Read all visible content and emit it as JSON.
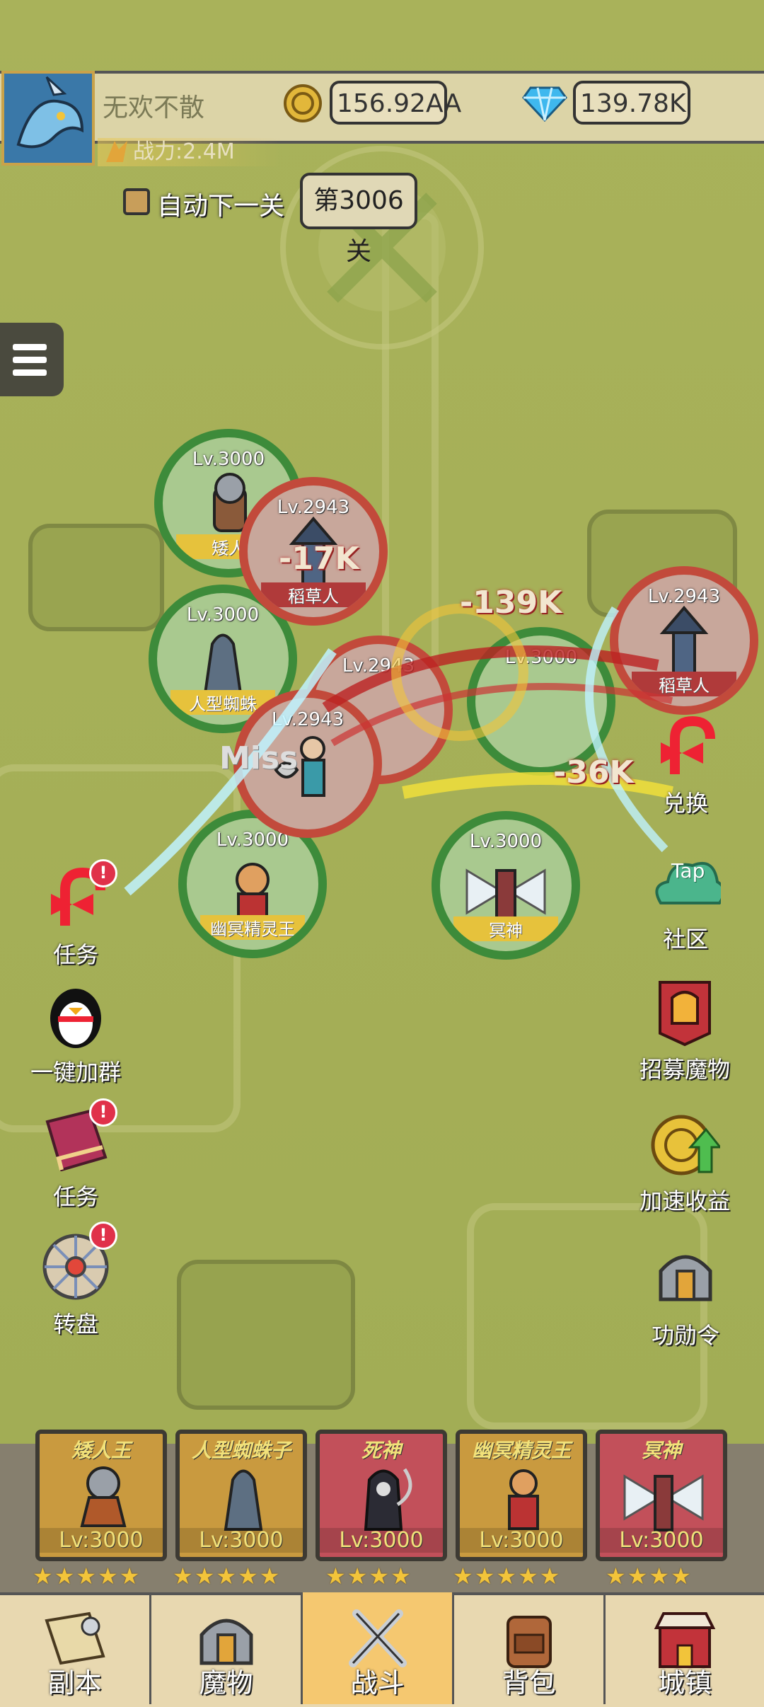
{
  "player": {
    "name": "无欢不散",
    "power": "战力:2.4M",
    "gold": "156.92AA",
    "diamonds": "139.78K"
  },
  "stage": {
    "auto_next": "自动下一关",
    "current": "第3006关"
  },
  "battle": {
    "allies": [
      {
        "level": "Lv.3000",
        "name": "矮人"
      },
      {
        "level": "Lv.3000",
        "name": "人型蜘蛛"
      },
      {
        "level": "Lv.3000",
        "name": "幽冥精灵王"
      },
      {
        "level": "Lv.3000",
        "name": "冥神"
      },
      {
        "level": "Lv.3000",
        "name": ""
      }
    ],
    "enemies": [
      {
        "level": "Lv.2943",
        "name": "稻草人"
      },
      {
        "level": "Lv.2943",
        "name": ""
      },
      {
        "level": "Lv.2943",
        "name": ""
      },
      {
        "level": "Lv.2943",
        "name": "稻草人"
      }
    ],
    "damage": [
      "-17K",
      "-139K",
      "-36K",
      "Miss"
    ]
  },
  "side_left": [
    {
      "label": "任务",
      "icon": "candy-cane-icon",
      "alert": "!"
    },
    {
      "label": "一键加群",
      "icon": "penguin-icon",
      "alert": ""
    },
    {
      "label": "任务",
      "icon": "book-icon",
      "alert": "!"
    },
    {
      "label": "转盘",
      "icon": "wheel-icon",
      "alert": "!"
    }
  ],
  "side_right": [
    {
      "label": "兑换",
      "icon": "candy-cane-icon"
    },
    {
      "label": "社区",
      "icon": "tap-cloud-icon",
      "tag": "Tap"
    },
    {
      "label": "招募魔物",
      "icon": "banner-helmet-icon"
    },
    {
      "label": "加速收益",
      "icon": "coin-arrow-icon"
    },
    {
      "label": "功勋令",
      "icon": "helmet-icon"
    }
  ],
  "heroes": [
    {
      "name": "矮人王",
      "level": "Lv:3000",
      "stars": "★★★★★",
      "color": "#c99a3f"
    },
    {
      "name": "人型蜘蛛子",
      "level": "Lv:3000",
      "stars": "★★★★★",
      "color": "#c99a3f"
    },
    {
      "name": "死神",
      "level": "Lv:3000",
      "stars": "★★★★",
      "color": "#c2505a"
    },
    {
      "name": "幽冥精灵王",
      "level": "Lv:3000",
      "stars": "★★★★★",
      "color": "#c99a3f"
    },
    {
      "name": "冥神",
      "level": "Lv:3000",
      "stars": "★★★★",
      "color": "#c2505a"
    }
  ],
  "nav": [
    "副本",
    "魔物",
    "战斗",
    "背包",
    "城镇"
  ]
}
